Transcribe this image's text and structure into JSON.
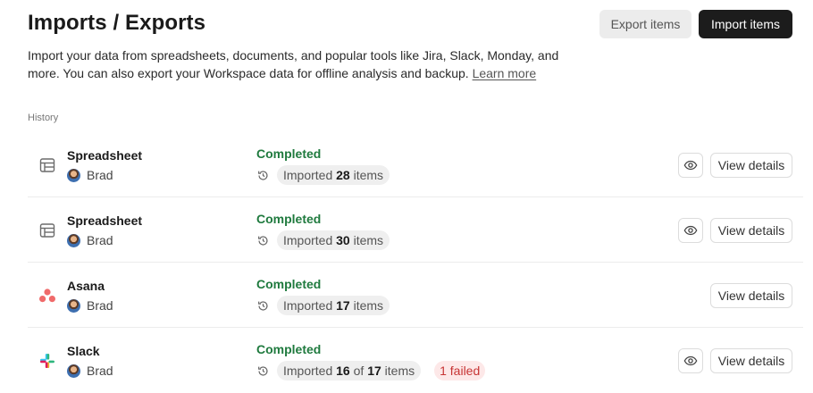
{
  "header": {
    "title": "Imports / Exports",
    "export_label": "Export items",
    "import_label": "Import items"
  },
  "description": {
    "text": "Import your data from spreadsheets, documents, and popular tools like Jira, Slack, Monday, and more. You can also export your Workspace data for offline analysis and backup.",
    "learn_more": "Learn more"
  },
  "history": {
    "label": "History",
    "items": [
      {
        "source": "Spreadsheet",
        "icon": "table-icon",
        "user": "Brad",
        "status": "Completed",
        "imported_prefix": "Imported",
        "imported_count": "28",
        "of_word": "",
        "total": "",
        "items_word": "items",
        "failed": "",
        "has_preview": true,
        "details_label": "View details"
      },
      {
        "source": "Spreadsheet",
        "icon": "table-icon",
        "user": "Brad",
        "status": "Completed",
        "imported_prefix": "Imported",
        "imported_count": "30",
        "of_word": "",
        "total": "",
        "items_word": "items",
        "failed": "",
        "has_preview": true,
        "details_label": "View details"
      },
      {
        "source": "Asana",
        "icon": "asana-logo-icon",
        "user": "Brad",
        "status": "Completed",
        "imported_prefix": "Imported",
        "imported_count": "17",
        "of_word": "",
        "total": "",
        "items_word": "items",
        "failed": "",
        "has_preview": false,
        "details_label": "View details"
      },
      {
        "source": "Slack",
        "icon": "slack-logo-icon",
        "user": "Brad",
        "status": "Completed",
        "imported_prefix": "Imported",
        "imported_count": "16",
        "of_word": "of",
        "total": "17",
        "items_word": "items",
        "failed": "1 failed",
        "has_preview": true,
        "details_label": "View details"
      }
    ]
  },
  "colors": {
    "status_completed": "#1f7a3e",
    "failed_text": "#c73434",
    "failed_bg": "#fde8e8",
    "primary_button": "#1c1c1c"
  }
}
